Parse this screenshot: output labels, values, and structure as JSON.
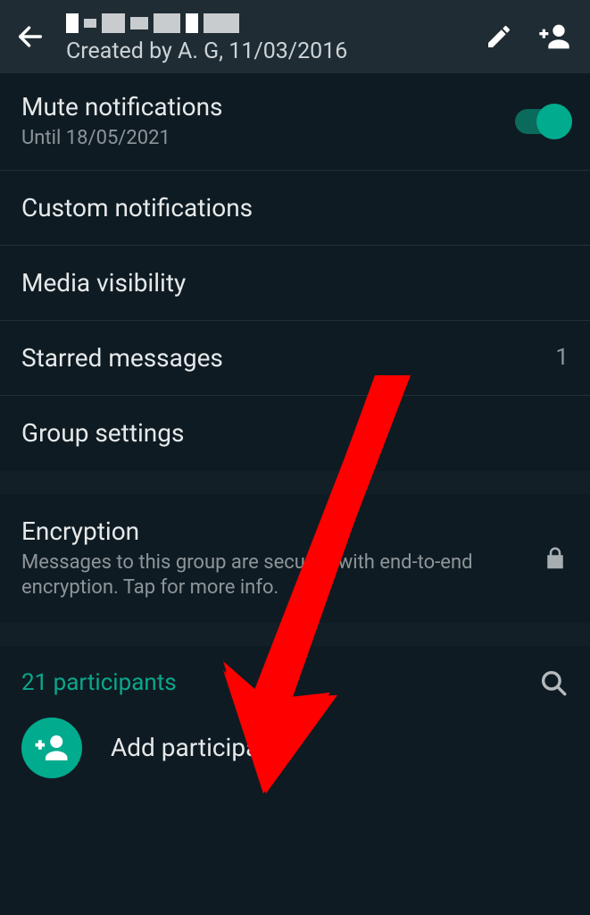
{
  "header": {
    "subtitle": "Created by A. G, 11/03/2016"
  },
  "rows": {
    "mute": {
      "title": "Mute notifications",
      "sub": "Until 18/05/2021"
    },
    "custom": {
      "title": "Custom notifications"
    },
    "media": {
      "title": "Media visibility"
    },
    "starred": {
      "title": "Starred messages",
      "count": "1"
    },
    "groupSettings": {
      "title": "Group settings"
    },
    "encryption": {
      "title": "Encryption",
      "sub": "Messages to this group are secured with end-to-end encryption. Tap for more info."
    }
  },
  "participants": {
    "count": "21 participants",
    "add": "Add participants"
  },
  "colors": {
    "accent": "#00ab8e"
  }
}
